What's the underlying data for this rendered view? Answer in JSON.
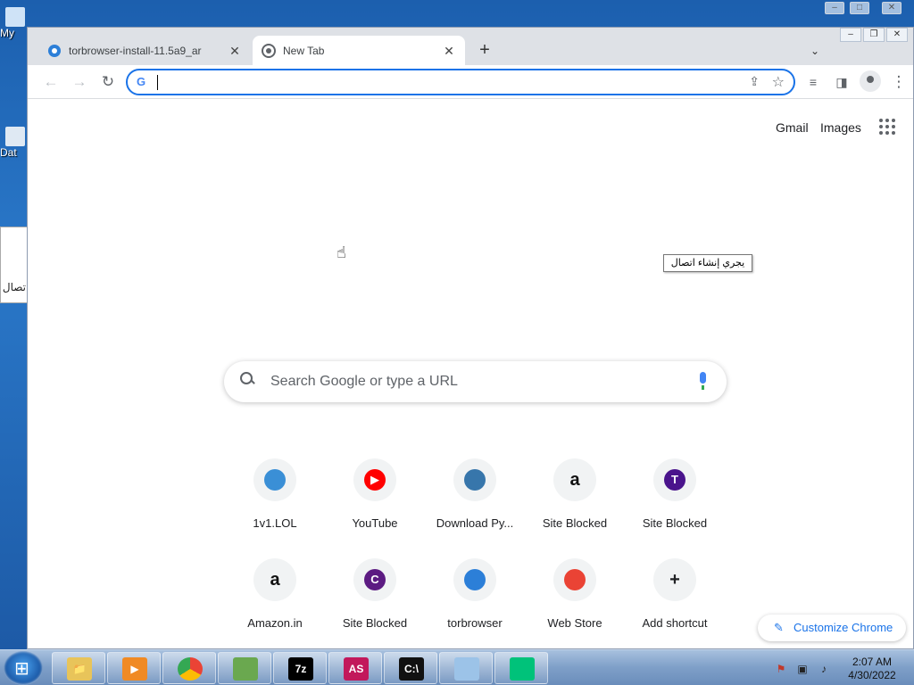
{
  "desktop": {
    "icons": [
      {
        "label": "My",
        "name": "desktop-icon-my-computer"
      },
      {
        "label": "Dat",
        "name": "desktop-icon-data"
      }
    ],
    "behind_window_text": "تصال ."
  },
  "browser": {
    "tabs": [
      {
        "title": "torbrowser-install-11.5a9_ar",
        "active": false
      },
      {
        "title": "New Tab",
        "active": true
      }
    ],
    "newtab_symbol": "+",
    "close_symbol": "✕",
    "omnibox": {
      "value": "",
      "placeholder": "",
      "g_mark": "G"
    }
  },
  "page": {
    "top_links": {
      "gmail": "Gmail",
      "images": "Images"
    },
    "tooltip": "يجري إنشاء اتصال",
    "search": {
      "placeholder": "Search Google or type a URL"
    },
    "shortcuts": [
      {
        "label": "1v1.LOL",
        "letter": "",
        "color": "#3a8fd6"
      },
      {
        "label": "YouTube",
        "letter": "▶",
        "color": "#ff0000"
      },
      {
        "label": "Download Py...",
        "letter": "",
        "color": "#3776ab"
      },
      {
        "label": "Site Blocked",
        "letter": "a",
        "color": "#111111"
      },
      {
        "label": "Site Blocked",
        "letter": "T",
        "color": "#4a148c"
      },
      {
        "label": "Amazon.in",
        "letter": "a",
        "color": "#111111"
      },
      {
        "label": "Site Blocked",
        "letter": "C",
        "color": "#5c1b82"
      },
      {
        "label": "torbrowser",
        "letter": "",
        "color": "#2c7fd8"
      },
      {
        "label": "Web Store",
        "letter": "",
        "color": "#ea4335"
      },
      {
        "label": "Add shortcut",
        "letter": "+",
        "color": "#202124"
      }
    ],
    "customize": "Customize Chrome"
  },
  "taskbar": {
    "items": [
      {
        "name": "explorer",
        "glyph": "📁",
        "color": "#e8c45a"
      },
      {
        "name": "media-player",
        "glyph": "▶",
        "color": "#f08a24"
      },
      {
        "name": "chrome",
        "glyph": "",
        "color": "#4285f4"
      },
      {
        "name": "notepad-chart",
        "glyph": "",
        "color": "#6aa84f"
      },
      {
        "name": "7zip",
        "glyph": "7z",
        "color": "#000000"
      },
      {
        "name": "as-app",
        "glyph": "AS",
        "color": "#c2185b"
      },
      {
        "name": "cmd",
        "glyph": "C:\\",
        "color": "#111111"
      },
      {
        "name": "notepad",
        "glyph": "",
        "color": "#9cc3e8"
      },
      {
        "name": "vpn-app",
        "glyph": "",
        "color": "#00c27a"
      }
    ],
    "clock": {
      "time": "2:07 AM",
      "date": "4/30/2022"
    }
  }
}
